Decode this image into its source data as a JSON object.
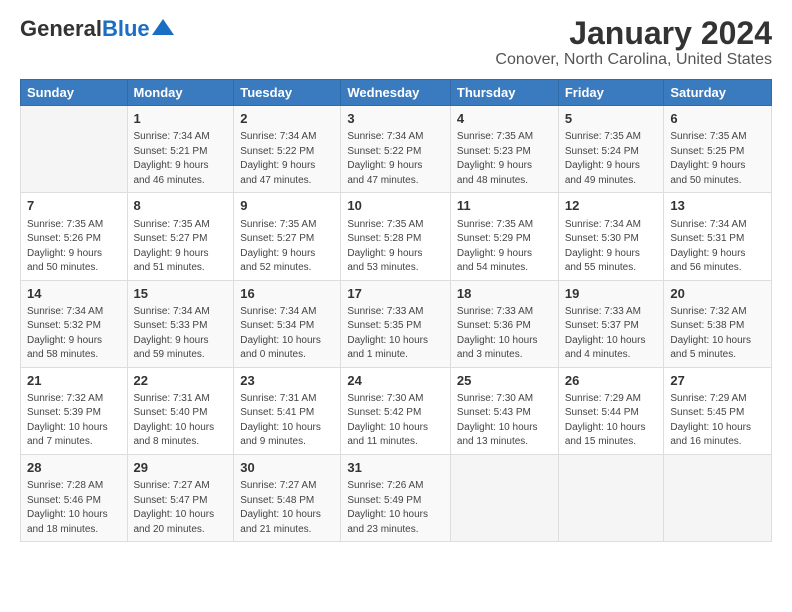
{
  "header": {
    "logo_general": "General",
    "logo_blue": "Blue",
    "title": "January 2024",
    "subtitle": "Conover, North Carolina, United States"
  },
  "days_of_week": [
    "Sunday",
    "Monday",
    "Tuesday",
    "Wednesday",
    "Thursday",
    "Friday",
    "Saturday"
  ],
  "weeks": [
    [
      {
        "day": "",
        "info": ""
      },
      {
        "day": "1",
        "info": "Sunrise: 7:34 AM\nSunset: 5:21 PM\nDaylight: 9 hours\nand 46 minutes."
      },
      {
        "day": "2",
        "info": "Sunrise: 7:34 AM\nSunset: 5:22 PM\nDaylight: 9 hours\nand 47 minutes."
      },
      {
        "day": "3",
        "info": "Sunrise: 7:34 AM\nSunset: 5:22 PM\nDaylight: 9 hours\nand 47 minutes."
      },
      {
        "day": "4",
        "info": "Sunrise: 7:35 AM\nSunset: 5:23 PM\nDaylight: 9 hours\nand 48 minutes."
      },
      {
        "day": "5",
        "info": "Sunrise: 7:35 AM\nSunset: 5:24 PM\nDaylight: 9 hours\nand 49 minutes."
      },
      {
        "day": "6",
        "info": "Sunrise: 7:35 AM\nSunset: 5:25 PM\nDaylight: 9 hours\nand 50 minutes."
      }
    ],
    [
      {
        "day": "7",
        "info": "Sunrise: 7:35 AM\nSunset: 5:26 PM\nDaylight: 9 hours\nand 50 minutes."
      },
      {
        "day": "8",
        "info": "Sunrise: 7:35 AM\nSunset: 5:27 PM\nDaylight: 9 hours\nand 51 minutes."
      },
      {
        "day": "9",
        "info": "Sunrise: 7:35 AM\nSunset: 5:27 PM\nDaylight: 9 hours\nand 52 minutes."
      },
      {
        "day": "10",
        "info": "Sunrise: 7:35 AM\nSunset: 5:28 PM\nDaylight: 9 hours\nand 53 minutes."
      },
      {
        "day": "11",
        "info": "Sunrise: 7:35 AM\nSunset: 5:29 PM\nDaylight: 9 hours\nand 54 minutes."
      },
      {
        "day": "12",
        "info": "Sunrise: 7:34 AM\nSunset: 5:30 PM\nDaylight: 9 hours\nand 55 minutes."
      },
      {
        "day": "13",
        "info": "Sunrise: 7:34 AM\nSunset: 5:31 PM\nDaylight: 9 hours\nand 56 minutes."
      }
    ],
    [
      {
        "day": "14",
        "info": "Sunrise: 7:34 AM\nSunset: 5:32 PM\nDaylight: 9 hours\nand 58 minutes."
      },
      {
        "day": "15",
        "info": "Sunrise: 7:34 AM\nSunset: 5:33 PM\nDaylight: 9 hours\nand 59 minutes."
      },
      {
        "day": "16",
        "info": "Sunrise: 7:34 AM\nSunset: 5:34 PM\nDaylight: 10 hours\nand 0 minutes."
      },
      {
        "day": "17",
        "info": "Sunrise: 7:33 AM\nSunset: 5:35 PM\nDaylight: 10 hours\nand 1 minute."
      },
      {
        "day": "18",
        "info": "Sunrise: 7:33 AM\nSunset: 5:36 PM\nDaylight: 10 hours\nand 3 minutes."
      },
      {
        "day": "19",
        "info": "Sunrise: 7:33 AM\nSunset: 5:37 PM\nDaylight: 10 hours\nand 4 minutes."
      },
      {
        "day": "20",
        "info": "Sunrise: 7:32 AM\nSunset: 5:38 PM\nDaylight: 10 hours\nand 5 minutes."
      }
    ],
    [
      {
        "day": "21",
        "info": "Sunrise: 7:32 AM\nSunset: 5:39 PM\nDaylight: 10 hours\nand 7 minutes."
      },
      {
        "day": "22",
        "info": "Sunrise: 7:31 AM\nSunset: 5:40 PM\nDaylight: 10 hours\nand 8 minutes."
      },
      {
        "day": "23",
        "info": "Sunrise: 7:31 AM\nSunset: 5:41 PM\nDaylight: 10 hours\nand 9 minutes."
      },
      {
        "day": "24",
        "info": "Sunrise: 7:30 AM\nSunset: 5:42 PM\nDaylight: 10 hours\nand 11 minutes."
      },
      {
        "day": "25",
        "info": "Sunrise: 7:30 AM\nSunset: 5:43 PM\nDaylight: 10 hours\nand 13 minutes."
      },
      {
        "day": "26",
        "info": "Sunrise: 7:29 AM\nSunset: 5:44 PM\nDaylight: 10 hours\nand 15 minutes."
      },
      {
        "day": "27",
        "info": "Sunrise: 7:29 AM\nSunset: 5:45 PM\nDaylight: 10 hours\nand 16 minutes."
      }
    ],
    [
      {
        "day": "28",
        "info": "Sunrise: 7:28 AM\nSunset: 5:46 PM\nDaylight: 10 hours\nand 18 minutes."
      },
      {
        "day": "29",
        "info": "Sunrise: 7:27 AM\nSunset: 5:47 PM\nDaylight: 10 hours\nand 20 minutes."
      },
      {
        "day": "30",
        "info": "Sunrise: 7:27 AM\nSunset: 5:48 PM\nDaylight: 10 hours\nand 21 minutes."
      },
      {
        "day": "31",
        "info": "Sunrise: 7:26 AM\nSunset: 5:49 PM\nDaylight: 10 hours\nand 23 minutes."
      },
      {
        "day": "",
        "info": ""
      },
      {
        "day": "",
        "info": ""
      },
      {
        "day": "",
        "info": ""
      }
    ]
  ]
}
